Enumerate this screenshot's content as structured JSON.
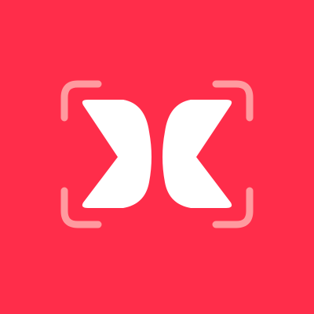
{
  "icon": {
    "name": "scan-x-logo-icon",
    "colors": {
      "background": "#ff2d4a",
      "glyph": "#ffffff",
      "frame_corners": "#ff9a9f"
    }
  }
}
